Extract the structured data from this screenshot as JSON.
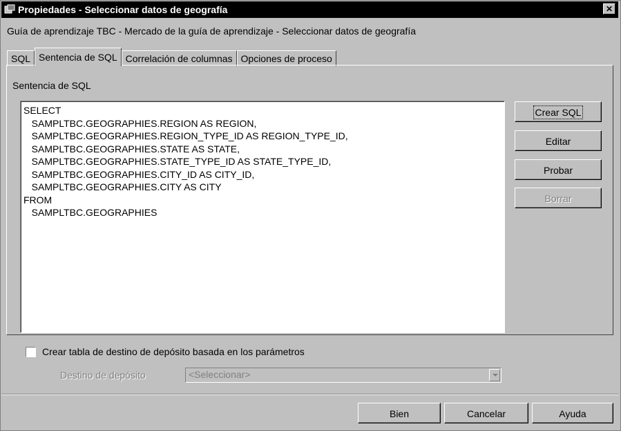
{
  "window": {
    "title": "Propiedades - Seleccionar datos de geografía",
    "subtitle": "Guía de aprendizaje TBC - Mercado de la guía de aprendizaje - Seleccionar datos de geografía"
  },
  "tabs": [
    {
      "label": "SQL"
    },
    {
      "label": "Sentencia de SQL",
      "active": true
    },
    {
      "label": "Correlación de columnas"
    },
    {
      "label": "Opciones de proceso"
    }
  ],
  "panel": {
    "label": "Sentencia de SQL",
    "sql_text": "SELECT\n   SAMPLTBC.GEOGRAPHIES.REGION AS REGION,\n   SAMPLTBC.GEOGRAPHIES.REGION_TYPE_ID AS REGION_TYPE_ID,\n   SAMPLTBC.GEOGRAPHIES.STATE AS STATE,\n   SAMPLTBC.GEOGRAPHIES.STATE_TYPE_ID AS STATE_TYPE_ID,\n   SAMPLTBC.GEOGRAPHIES.CITY_ID AS CITY_ID,\n   SAMPLTBC.GEOGRAPHIES.CITY AS CITY\nFROM\n   SAMPLTBC.GEOGRAPHIES"
  },
  "side_buttons": {
    "crear_sql": "Crear SQL",
    "editar": "Editar",
    "probar": "Probar",
    "borrar": "Borrar"
  },
  "options": {
    "checkbox_label": "Crear tabla de destino de depósito basada en los parámetros",
    "dest_label": "Destino de depósito",
    "dest_value": "<Seleccionar>"
  },
  "footer": {
    "ok": "Bien",
    "cancel": "Cancelar",
    "help": "Ayuda"
  }
}
